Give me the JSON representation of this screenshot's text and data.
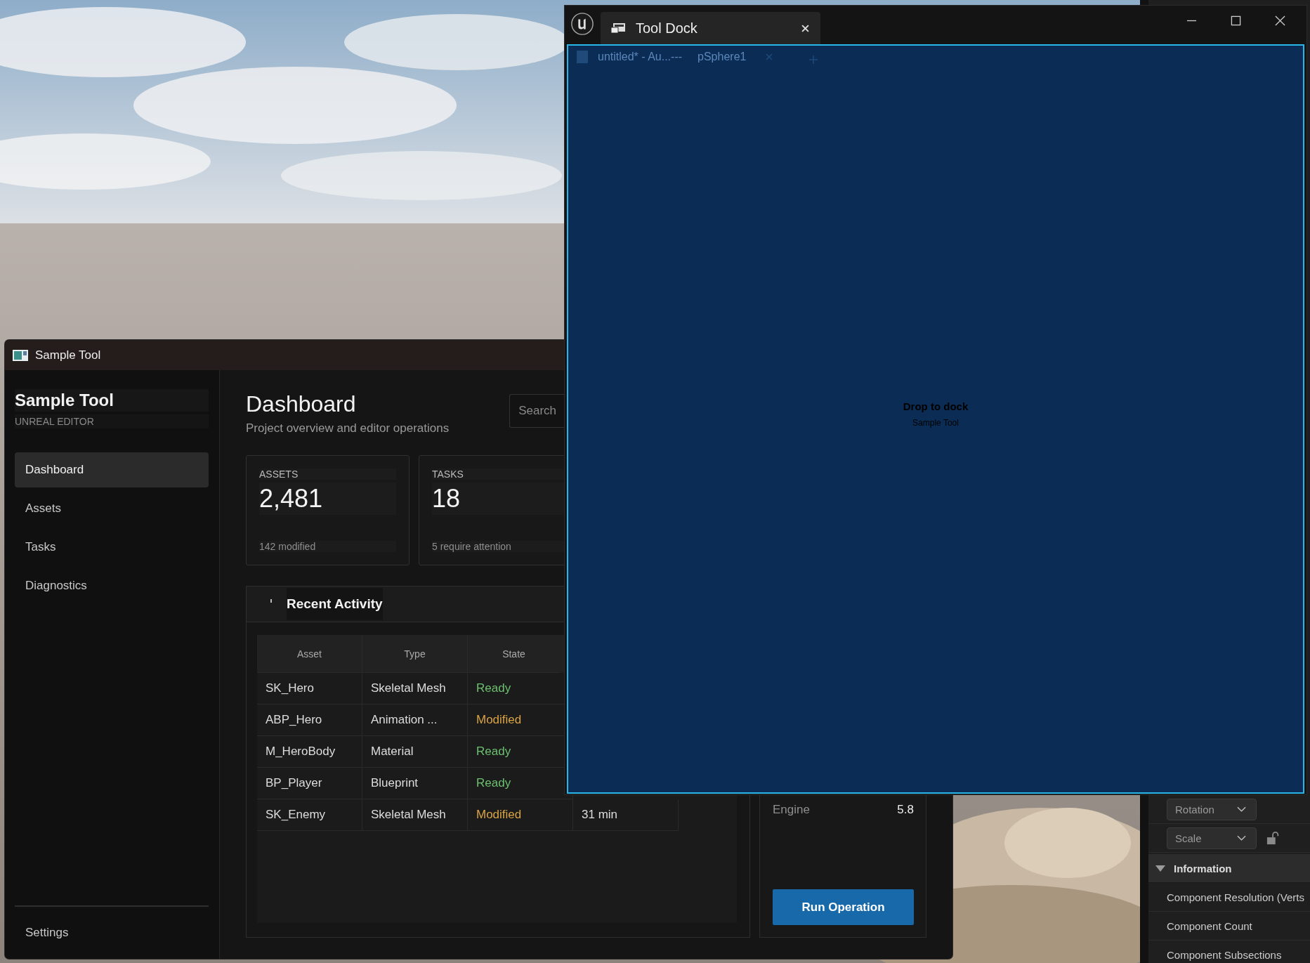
{
  "sample_tool": {
    "title": "Sample Tool",
    "sidebar": {
      "brand": "Sample Tool",
      "subtitle": "UNREAL EDITOR",
      "items": [
        {
          "label": "Dashboard",
          "selected": true
        },
        {
          "label": "Assets",
          "selected": false
        },
        {
          "label": "Tasks",
          "selected": false
        },
        {
          "label": "Diagnostics",
          "selected": false
        }
      ],
      "footer_item": "Settings"
    },
    "header": {
      "title": "Dashboard",
      "subtitle": "Project overview and editor operations",
      "search": {
        "placeholder": "Search"
      }
    },
    "stats": [
      {
        "label": "ASSETS",
        "value": "2,481",
        "note": "142 modified"
      },
      {
        "label": "TASKS",
        "value": "18",
        "note": "5 require attention"
      }
    ],
    "recent_activity": {
      "title": "Recent Activity",
      "table": {
        "columns": [
          "Asset",
          "Type",
          "State"
        ],
        "rows": [
          {
            "cells": [
              "SK_Hero",
              "Skeletal Mesh",
              "Ready"
            ],
            "color": "#6cc070"
          },
          {
            "cells": [
              "ABP_Hero",
              "Animation ...",
              "Modified"
            ],
            "color": "#d9a444"
          },
          {
            "cells": [
              "M_HeroBody",
              "Material",
              "Ready"
            ],
            "color": "#6cc070"
          },
          {
            "cells": [
              "BP_Player",
              "Blueprint",
              "Ready"
            ],
            "color": "#6cc070"
          },
          {
            "cells": [
              "SK_Enemy",
              "Skeletal Mesh",
              "Modified",
              "31 min"
            ],
            "color": "#d9a444"
          }
        ]
      }
    },
    "info_card": {
      "rows": [
        {
          "label": "Engine",
          "value": "5.8"
        }
      ],
      "button": "Run Operation"
    }
  },
  "tool_dock": {
    "tab": "Tool Dock",
    "inner_tab": {
      "title": "untitled* - Au...---",
      "object": "pSphere1"
    },
    "drop_hint": "Drop to dock",
    "drop_source": "Sample Tool"
  },
  "details_panel": {
    "dropdowns": [
      "Rotation",
      "Scale"
    ],
    "section": {
      "title": "Information",
      "expanded": true,
      "rows": [
        "Component Resolution (Verts",
        "Component Count",
        "Component Subsections"
      ]
    }
  }
}
